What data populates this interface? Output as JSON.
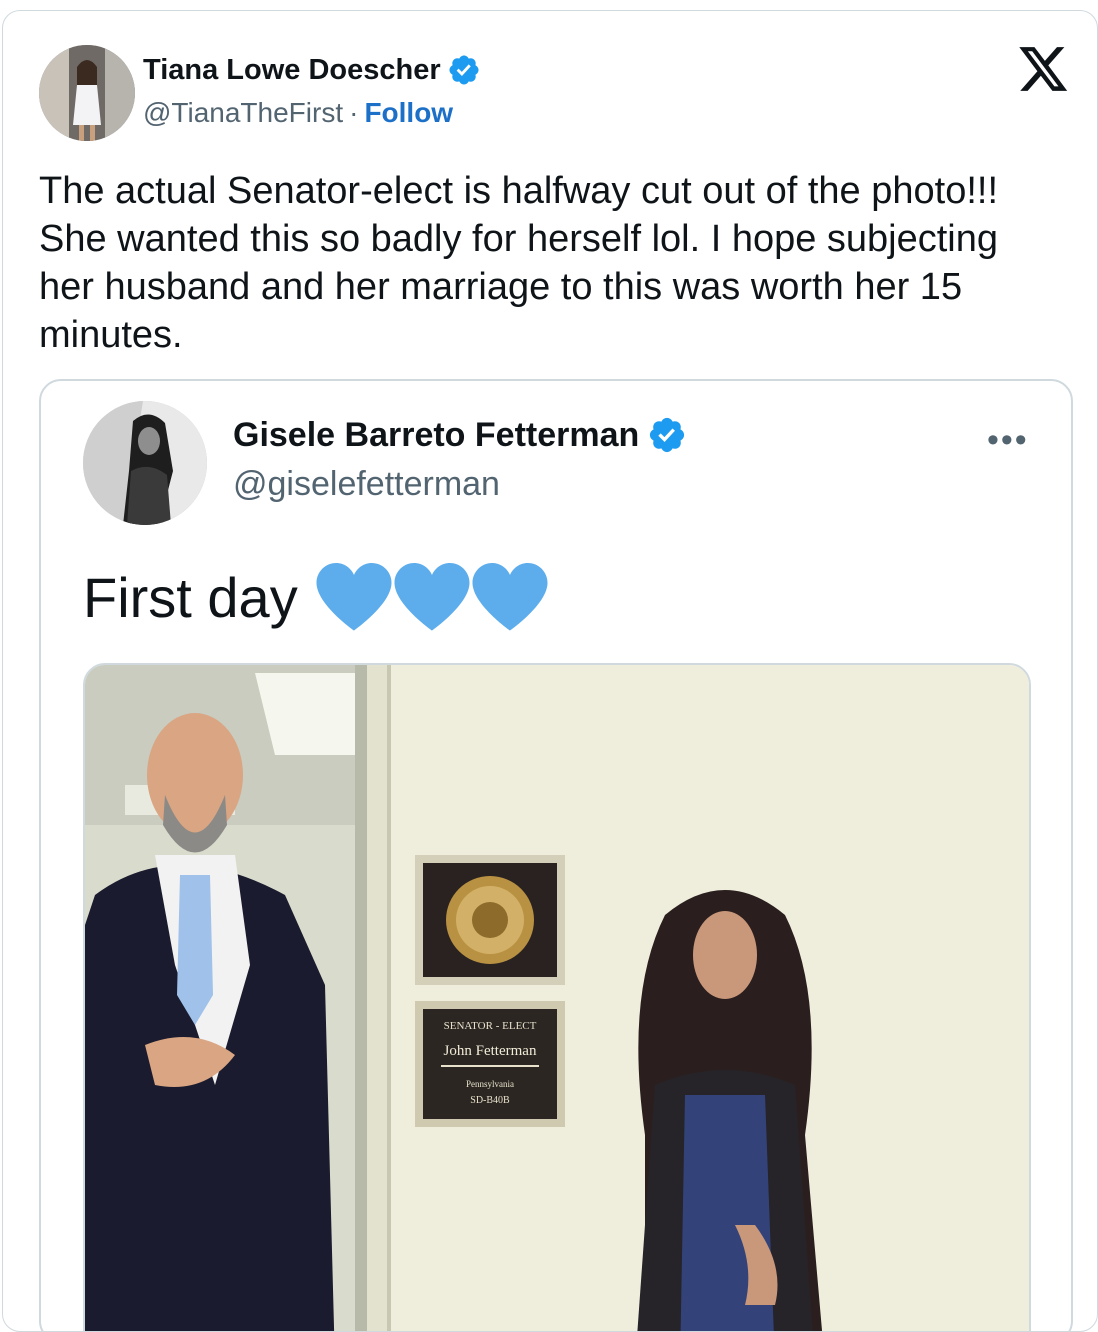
{
  "tweet": {
    "author_name": "Tiana Lowe Doescher",
    "author_handle": "@TianaTheFirst",
    "separator": "·",
    "follow_label": "Follow",
    "text": "The actual Senator-elect is halfway cut out of the photo!!! She wanted this so badly for herself lol. I hope subjecting her husband and her marriage to this was worth her 15 minutes.",
    "platform_icon": "x-logo-icon"
  },
  "quoted_tweet": {
    "author_name": "Gisele Barreto Fetterman",
    "author_handle": "@giselefetterman",
    "more_label": "•••",
    "text": "First day",
    "emoji": [
      "blue-heart-icon",
      "blue-heart-icon",
      "blue-heart-icon"
    ],
    "photo": {
      "plaque_line1": "SENATOR - ELECT",
      "plaque_name": "John Fetterman",
      "plaque_state": "Pennsylvania",
      "plaque_room": "SD-B40B"
    }
  },
  "colors": {
    "verified": "#1d9bf0",
    "follow": "#1d70c8",
    "heart": "#5dadec",
    "text": "#0f1419",
    "muted": "#536471"
  }
}
